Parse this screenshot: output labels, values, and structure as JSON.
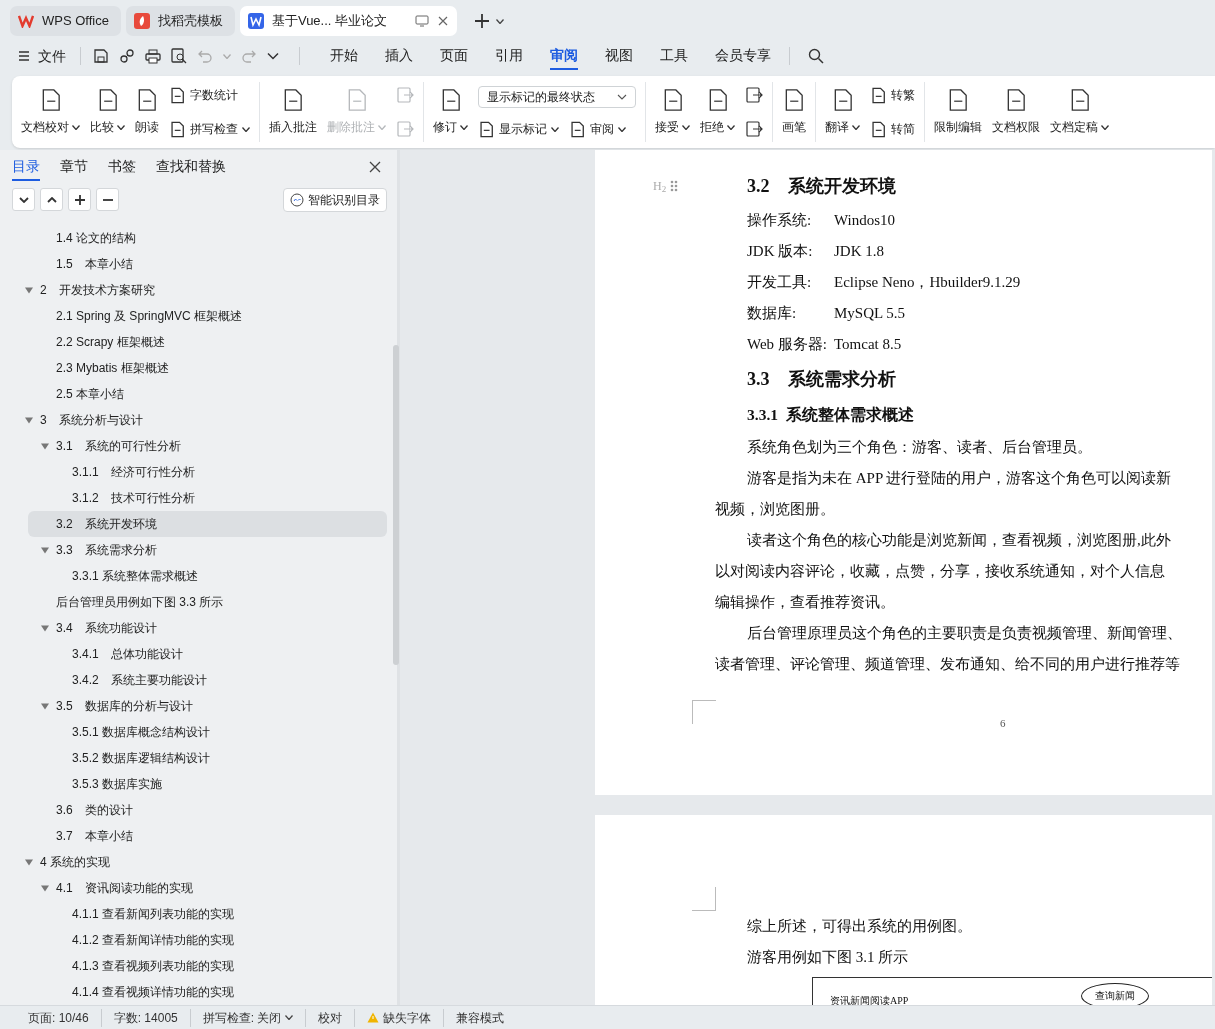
{
  "title_bar": {
    "tabs": [
      {
        "label": "WPS Office",
        "selected": false
      },
      {
        "label": "找稻壳模板",
        "selected": false
      },
      {
        "label": "基于Vue... 毕业论文",
        "selected": true
      }
    ]
  },
  "menu_bar": {
    "file_label": "文件",
    "tabs": [
      {
        "label": "开始",
        "selected": false
      },
      {
        "label": "插入",
        "selected": false
      },
      {
        "label": "页面",
        "selected": false
      },
      {
        "label": "引用",
        "selected": false
      },
      {
        "label": "审阅",
        "selected": true
      },
      {
        "label": "视图",
        "selected": false
      },
      {
        "label": "工具",
        "selected": false
      },
      {
        "label": "会员专享",
        "selected": false
      }
    ]
  },
  "ribbon": {
    "groups": [
      {
        "items": [
          {
            "kind": "large",
            "label": "文档校对",
            "caret": true,
            "disabled": false
          },
          {
            "kind": "large",
            "label": "比较",
            "caret": true,
            "disabled": false
          },
          {
            "kind": "large",
            "label": "朗读",
            "caret": false,
            "disabled": false
          },
          {
            "kind": "stack",
            "children": [
              {
                "kind": "small",
                "label": "字数统计",
                "caret": false,
                "disabled": false
              },
              {
                "kind": "small",
                "label": "拼写检查",
                "caret": true,
                "disabled": false
              }
            ]
          }
        ]
      },
      {
        "items": [
          {
            "kind": "large",
            "label": "插入批注",
            "caret": false,
            "disabled": false
          },
          {
            "kind": "large",
            "label": "删除批注",
            "caret": true,
            "disabled": true
          },
          {
            "kind": "stack",
            "children": [
              {
                "kind": "icon",
                "disabled": true
              },
              {
                "kind": "icon",
                "disabled": true
              }
            ]
          }
        ]
      },
      {
        "items": [
          {
            "kind": "large",
            "label": "修订",
            "caret": true,
            "disabled": false
          },
          {
            "kind": "stack",
            "children": [
              {
                "kind": "dropdown",
                "label": "显示标记的最终状态"
              },
              {
                "kind": "row",
                "children": [
                  {
                    "kind": "small",
                    "label": "显示标记",
                    "caret": true,
                    "disabled": false
                  },
                  {
                    "kind": "small",
                    "label": "审阅",
                    "caret": true,
                    "disabled": false
                  }
                ]
              }
            ]
          }
        ]
      },
      {
        "items": [
          {
            "kind": "large",
            "label": "接受",
            "caret": true,
            "disabled": false
          },
          {
            "kind": "large",
            "label": "拒绝",
            "caret": true,
            "disabled": false
          },
          {
            "kind": "stack",
            "children": [
              {
                "kind": "icon",
                "disabled": false
              },
              {
                "kind": "icon",
                "disabled": false
              }
            ]
          }
        ]
      },
      {
        "items": [
          {
            "kind": "large",
            "label": "画笔",
            "caret": false,
            "disabled": false
          }
        ]
      },
      {
        "items": [
          {
            "kind": "large",
            "label": "翻译",
            "caret": true,
            "disabled": false
          },
          {
            "kind": "stack",
            "children": [
              {
                "kind": "small",
                "label": "转繁",
                "caret": false,
                "disabled": false
              },
              {
                "kind": "small",
                "label": "转简",
                "caret": false,
                "disabled": false
              }
            ]
          }
        ]
      },
      {
        "items": [
          {
            "kind": "large",
            "label": "限制编辑",
            "caret": false,
            "disabled": false
          },
          {
            "kind": "large",
            "label": "文档权限",
            "caret": false,
            "disabled": false
          },
          {
            "kind": "large",
            "label": "文档定稿",
            "caret": true,
            "disabled": false
          }
        ]
      }
    ]
  },
  "side_panel": {
    "tabs": [
      {
        "label": "目录",
        "selected": true
      },
      {
        "label": "章节",
        "selected": false
      },
      {
        "label": "书签",
        "selected": false
      },
      {
        "label": "查找和替换",
        "selected": false
      }
    ],
    "smart_button": "智能识别目录",
    "toc": [
      {
        "children": [
          {
            "label": "1.4 论文的结构",
            "selected": false
          },
          {
            "label": "1.5　本章小结",
            "selected": false
          }
        ]
      },
      {
        "label": "2　开发技术方案研究",
        "selected": false,
        "expanded": true,
        "children": [
          {
            "label": "2.1 Spring 及 SpringMVC 框架概述",
            "selected": false
          },
          {
            "label": "2.2 Scrapy 框架概述",
            "selected": false
          },
          {
            "label": "2.3 Mybatis 框架概述",
            "selected": false
          },
          {
            "label": "2.5 本章小结",
            "selected": false
          }
        ]
      },
      {
        "label": "3　系统分析与设计",
        "selected": false,
        "expanded": true,
        "children": [
          {
            "label": "3.1　系统的可行性分析",
            "selected": false,
            "expanded": true,
            "children": [
              {
                "label": "3.1.1　经济可行性分析",
                "selected": false
              },
              {
                "label": "3.1.2　技术可行性分析",
                "selected": false
              }
            ]
          },
          {
            "label": "3.2　系统开发环境",
            "selected": true
          },
          {
            "label": "3.3　系统需求分析",
            "selected": false,
            "expanded": true,
            "children": [
              {
                "label": "3.3.1 系统整体需求概述",
                "selected": false
              }
            ]
          },
          {
            "label": "后台管理员用例如下图 3.3 所示",
            "selected": false
          },
          {
            "label": "3.4　系统功能设计",
            "selected": false,
            "expanded": true,
            "children": [
              {
                "label": "3.4.1　总体功能设计",
                "selected": false
              },
              {
                "label": "3.4.2　系统主要功能设计",
                "selected": false
              }
            ]
          },
          {
            "label": "3.5　数据库的分析与设计",
            "selected": false,
            "expanded": true,
            "children": [
              {
                "label": "3.5.1 数据库概念结构设计",
                "selected": false
              },
              {
                "label": "3.5.2 数据库逻辑结构设计",
                "selected": false
              },
              {
                "label": "3.5.3 数据库实施",
                "selected": false
              }
            ]
          },
          {
            "label": "3.6　类的设计",
            "selected": false
          },
          {
            "label": "3.7　本章小结",
            "selected": false
          }
        ]
      },
      {
        "label": "4 系统的实现",
        "selected": false,
        "expanded": true,
        "children": [
          {
            "label": "4.1　资讯阅读功能的实现",
            "selected": false,
            "expanded": true,
            "children": [
              {
                "label": "4.1.1 查看新闻列表功能的实现",
                "selected": false
              },
              {
                "label": "4.1.2 查看新闻详情功能的实现",
                "selected": false
              },
              {
                "label": "4.1.3 查看视频列表功能的实现",
                "selected": false
              },
              {
                "label": "4.1.4 查看视频详情功能的实现",
                "selected": false
              }
            ]
          }
        ]
      }
    ]
  },
  "document": {
    "pages": [
      {
        "blocks": [
          {
            "kind": "heading2",
            "marker": "H$_{2}$",
            "number": "3.2",
            "title": "系统开发环境"
          },
          {
            "kind": "field",
            "label": "操作系统:",
            "value": "Windos10"
          },
          {
            "kind": "field",
            "label": "JDK 版本:",
            "value": "JDK 1.8"
          },
          {
            "kind": "field",
            "label": "开发工具:",
            "value": "Eclipse Neno，Hbuilder9.1.29"
          },
          {
            "kind": "field",
            "label": "数据库:",
            "value": "MySQL 5.5"
          },
          {
            "kind": "field",
            "label": "Web 服务器:",
            "value": "Tomcat 8.5"
          },
          {
            "kind": "heading2",
            "number": "3.3",
            "title": "系统需求分析"
          },
          {
            "kind": "heading3",
            "number": "3.3.1",
            "title": "系统整体需求概述"
          },
          {
            "kind": "paragraph",
            "lines": [
              "系统角色划为三个角色：游客、读者、后台管理员。"
            ]
          },
          {
            "kind": "paragraph",
            "lines": [
              "游客是指为未在 APP 进行登陆的用户，游客这个角色可以阅读新",
              "视频，浏览图册。"
            ]
          },
          {
            "kind": "paragraph",
            "lines": [
              "读者这个角色的核心功能是浏览新闻，查看视频，浏览图册,此外",
              "以对阅读内容评论，收藏，点赞，分享，接收系统通知，对个人信息",
              "编辑操作，查看推荐资讯。"
            ]
          },
          {
            "kind": "paragraph",
            "lines": [
              "后台管理原理员这个角色的主要职责是负责视频管理、新闻管理、",
              "读者管理、评论管理、频道管理、发布通知、给不同的用户进行推荐等"
            ]
          }
        ],
        "page_number": "6"
      },
      {
        "blocks": [
          {
            "kind": "paragraph",
            "lines": [
              "综上所述，可得出系统的用例图。"
            ]
          },
          {
            "kind": "paragraph",
            "lines": [
              "游客用例如下图 3.1 所示"
            ]
          },
          {
            "kind": "figure",
            "title": "资讯新闻阅读APP",
            "use_case": "查询新闻"
          }
        ]
      }
    ]
  },
  "status_bar": {
    "items": [
      {
        "kind": "text",
        "label": "页面: 10/46"
      },
      {
        "kind": "text",
        "label": "字数: 14005"
      },
      {
        "kind": "dropdown",
        "label": "拼写检查: 关闭"
      },
      {
        "kind": "text",
        "label": "校对"
      },
      {
        "kind": "warning",
        "label": "缺失字体"
      },
      {
        "kind": "text",
        "label": "兼容模式"
      }
    ]
  }
}
